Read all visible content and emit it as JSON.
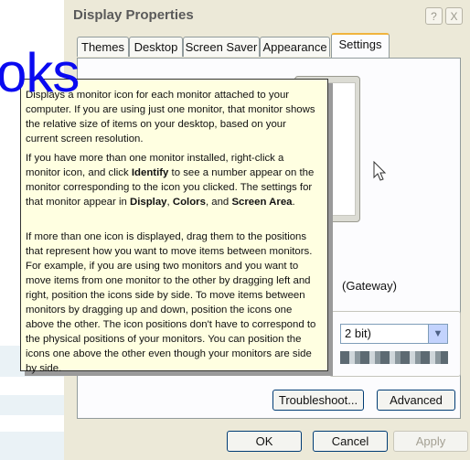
{
  "dialog": {
    "title": "Display Properties",
    "help_btn": "?",
    "close_btn": "X"
  },
  "tabs": [
    "Themes",
    "Desktop",
    "Screen Saver",
    "Appearance",
    "Settings"
  ],
  "active_tab": "Settings",
  "overlay_word": "oks",
  "help_popup": {
    "p1": "Displays a monitor icon for each monitor attached to your computer. If you are using just one monitor, that monitor shows the relative size of items on your desktop, based on your current screen resolution.",
    "p2_a": "If you have more than one monitor installed, right-click a monitor icon, and click ",
    "p2_identify": "Identify",
    "p2_b": " to see a number appear on the monitor corresponding to the icon you clicked. The settings for that monitor appear in ",
    "p2_display": "Display",
    "p2_c": ", ",
    "p2_colors": "Colors",
    "p2_d": ", and ",
    "p2_screen_area": "Screen Area",
    "p2_e": ".",
    "p3": "If more than one icon is displayed, drag them to the positions that represent how you want to move items between monitors. For example, if you are using two monitors and you want to move items from one monitor to the other by dragging left and right, position the icons side by side. To move items between monitors by dragging up and down, position the icons one above the other. The icon positions don't have to correspond to the physical positions of your monitors. You can position the icons one above the other even though your monitors are side by side."
  },
  "settings": {
    "display_name_fragment": "(Gateway)",
    "color_quality_value": "2 bit)"
  },
  "buttons": {
    "troubleshoot": "Troubleshoot...",
    "advanced": "Advanced",
    "ok": "OK",
    "cancel": "Cancel",
    "apply": "Apply"
  }
}
